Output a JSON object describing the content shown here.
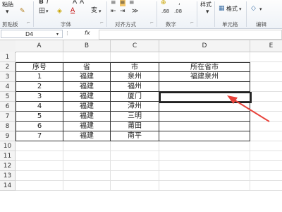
{
  "ribbon": {
    "paste_label": "粘贴",
    "clipboard_label": "剪贴板",
    "font_label": "字体",
    "alignment_label": "对齐方式",
    "number_label": "数字",
    "styles_label": "样式",
    "format_label": "格式",
    "cells_label": "单元格",
    "edit_label": "编辑",
    "expand_glyph": "⌐"
  },
  "formula_bar": {
    "name_box": "D4",
    "fx": "fx",
    "formula": ""
  },
  "columns": [
    "A",
    "B",
    "C",
    "D",
    "E"
  ],
  "rows": [
    "1",
    "2",
    "3",
    "4",
    "5",
    "6",
    "7",
    "8",
    "9",
    "10",
    "11",
    "12",
    "13",
    "14"
  ],
  "table": {
    "headers": [
      "序号",
      "省",
      "市",
      "所在省市"
    ],
    "data": [
      [
        "1",
        "福建",
        "泉州",
        "福建泉州"
      ],
      [
        "2",
        "福建",
        "福州",
        ""
      ],
      [
        "3",
        "福建",
        "厦门",
        ""
      ],
      [
        "4",
        "福建",
        "漳州",
        ""
      ],
      [
        "5",
        "福建",
        "三明",
        ""
      ],
      [
        "6",
        "福建",
        "莆田",
        ""
      ],
      [
        "7",
        "福建",
        "南平",
        ""
      ]
    ]
  },
  "annotation": {
    "arrow_color": "#e8423a"
  }
}
